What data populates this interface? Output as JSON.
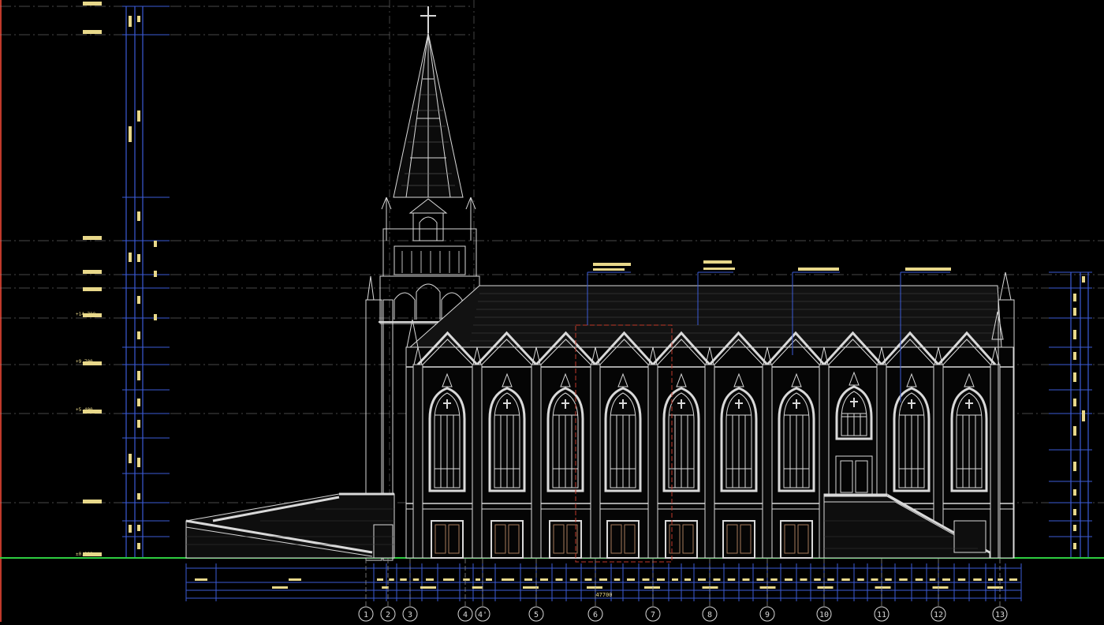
{
  "drawing": {
    "background": "#000000",
    "line_color": "#d9d9d9",
    "dim_color": "#3b5bd6",
    "text_color": "#e8d88a",
    "ground_color": "#2ecc40",
    "accent_color": "#c0392b"
  },
  "grid_axes": [
    "1",
    "2",
    "3",
    "4",
    "4'",
    "5",
    "6",
    "7",
    "8",
    "9",
    "10",
    "11",
    "12",
    "13"
  ],
  "levels": [
    {
      "label": "±0.000"
    },
    {
      "label": "+5.400"
    },
    {
      "label": "+9.700"
    },
    {
      "label": "+14.700"
    }
  ],
  "bottom_labels": {
    "total": "47700"
  }
}
